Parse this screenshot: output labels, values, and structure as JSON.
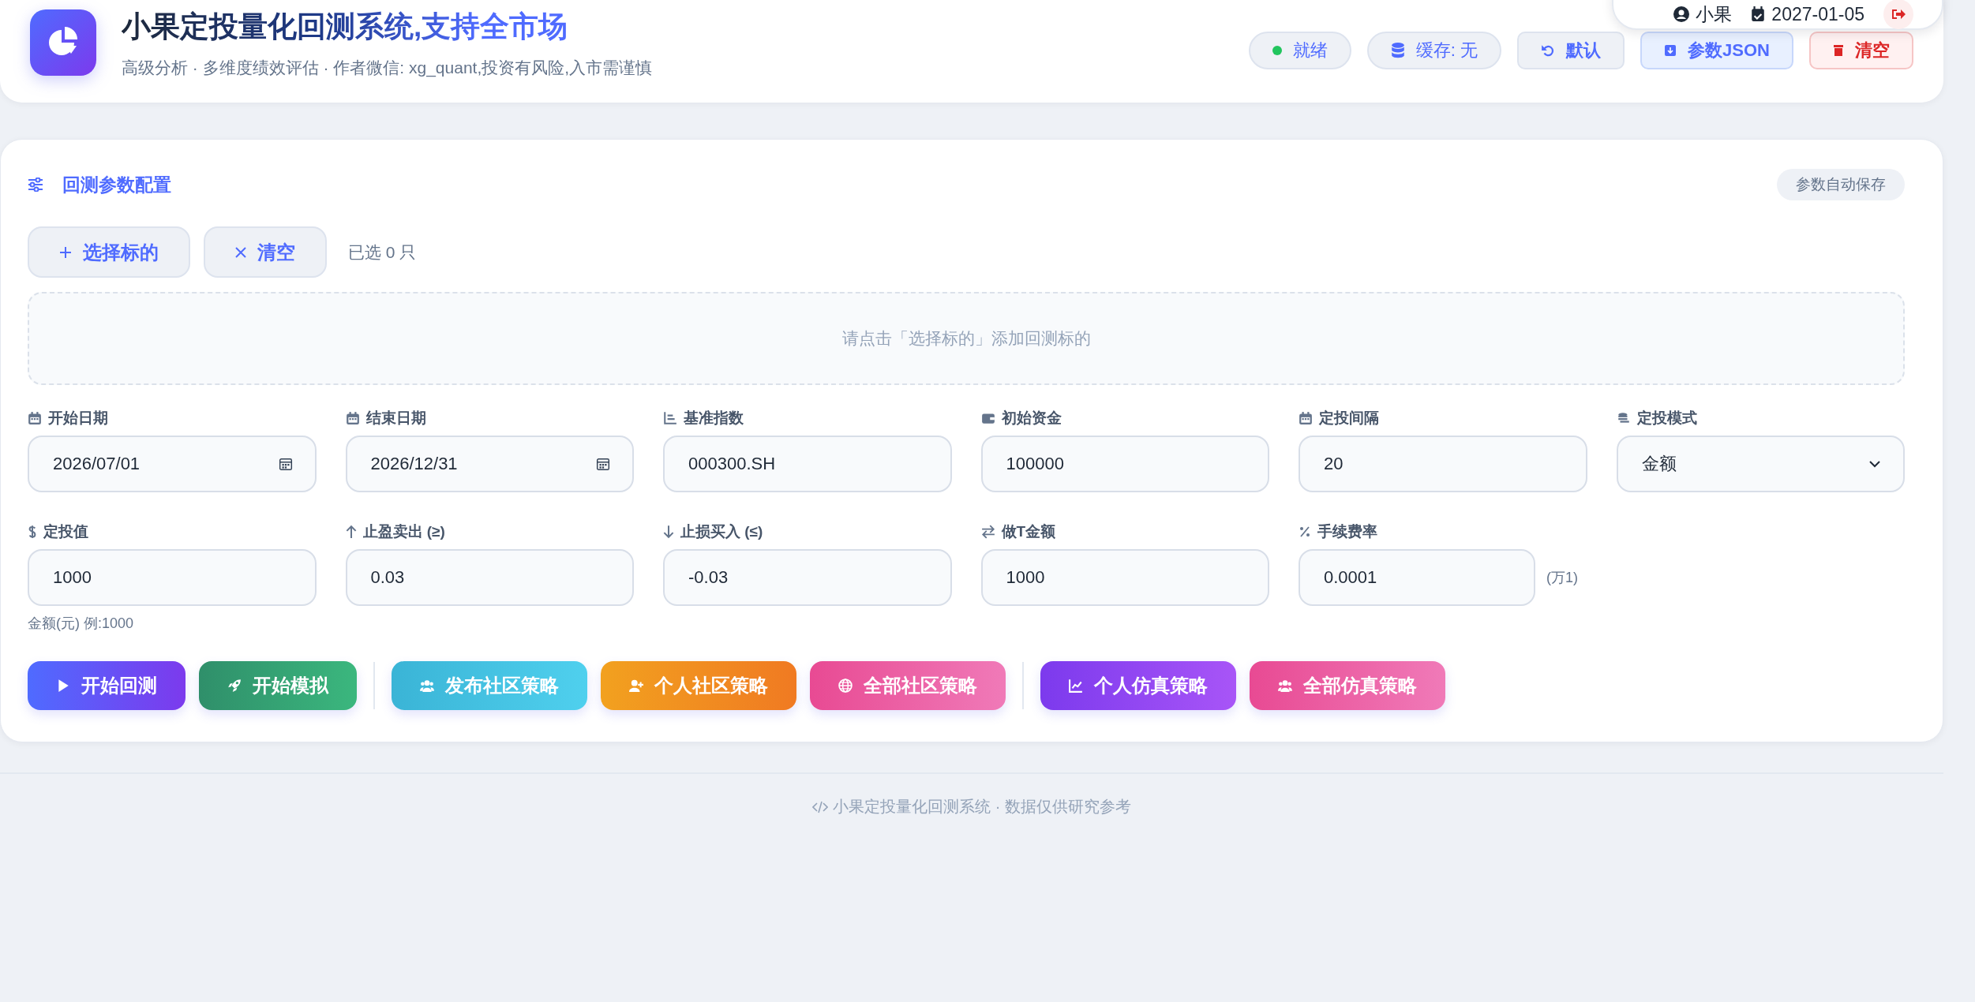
{
  "header": {
    "title": "小果定投量化回测系统,支持全市场",
    "subtitle": "高级分析 · 多维度绩效评估 · 作者微信: xg_quant,投资有风险,入市需谨慎",
    "controls": [
      {
        "kind": "status",
        "label": "就绪"
      },
      {
        "kind": "status",
        "label": "缓存: 无"
      },
      {
        "kind": "button",
        "label": "默认"
      },
      {
        "kind": "button",
        "label": "参数JSON"
      },
      {
        "kind": "danger",
        "label": "清空"
      }
    ]
  },
  "user_menu": {
    "user": "小果",
    "date": "2027-01-05"
  },
  "config": {
    "title": "回测参数配置",
    "badge": "参数自动保存",
    "select_button": "选择标的",
    "clear_button": "清空",
    "selected_count": "已选 0 只",
    "empty_hint": "请点击「选择标的」添加回测标的",
    "fields": [
      {
        "kind": "date",
        "label": "开始日期",
        "value": "2026/07/01"
      },
      {
        "kind": "date",
        "label": "结束日期",
        "value": "2026/12/31"
      },
      {
        "kind": "text",
        "label": "基准指数",
        "value": "000300.SH"
      },
      {
        "kind": "text",
        "label": "初始资金",
        "value": "100000"
      },
      {
        "kind": "text",
        "label": "定投间隔",
        "value": "20"
      },
      {
        "kind": "select",
        "label": "定投模式",
        "value": "金额"
      },
      {
        "kind": "text",
        "label": "定投值",
        "value": "1000",
        "hint": "金额(元) 例:1000"
      },
      {
        "kind": "text",
        "label": "止盈卖出 (≥)",
        "value": "0.03"
      },
      {
        "kind": "text",
        "label": "止损买入 (≤)",
        "value": "-0.03"
      },
      {
        "kind": "text",
        "label": "做T金额",
        "value": "1000"
      },
      {
        "kind": "text",
        "label": "手续费率",
        "value": "0.0001",
        "suffix": "(万1)"
      }
    ],
    "actions": [
      {
        "label": "开始回测"
      },
      {
        "label": "开始模拟"
      },
      {
        "label": "发布社区策略"
      },
      {
        "label": "个人社区策略"
      },
      {
        "label": "全部社区策略"
      },
      {
        "label": "个人仿真策略"
      },
      {
        "label": "全部仿真策略"
      }
    ]
  },
  "footer": "小果定投量化回测系统 · 数据仅供研究参考"
}
